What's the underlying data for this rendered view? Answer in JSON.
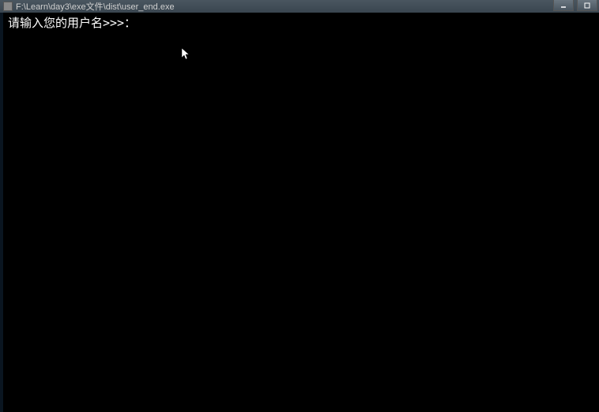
{
  "window": {
    "title": "F:\\Learn\\day3\\exe文件\\dist\\user_end.exe"
  },
  "console": {
    "prompt": "请输入您的用户名>>>："
  }
}
